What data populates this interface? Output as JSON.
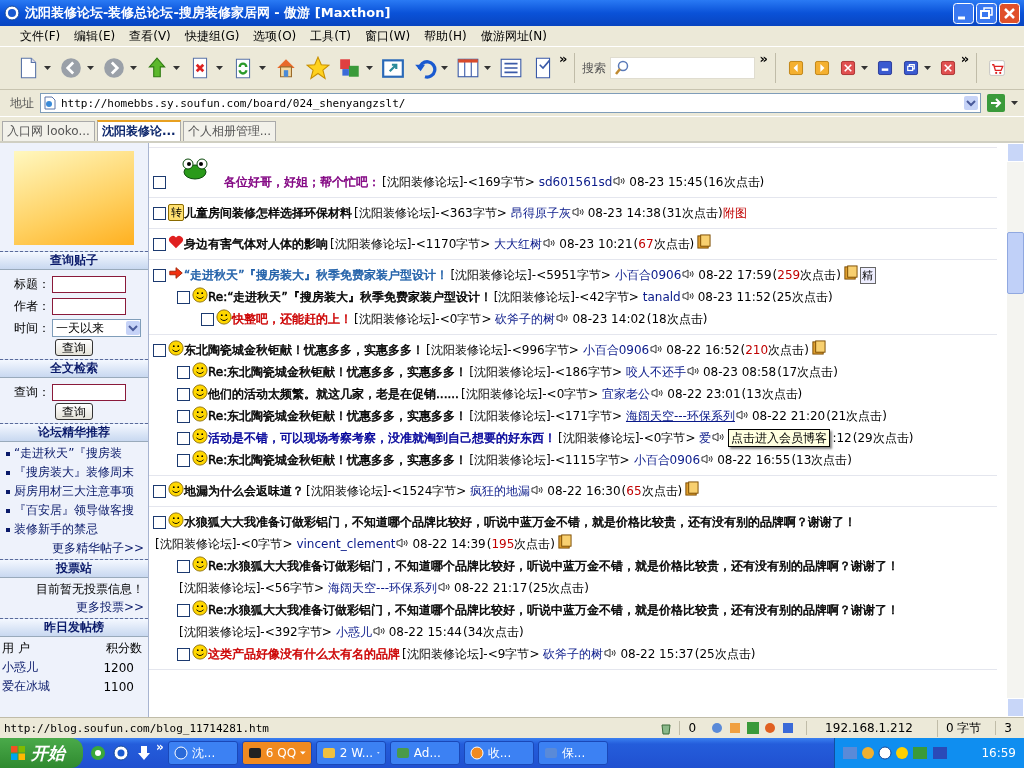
{
  "window": {
    "title": "沈阳装修论坛-装修总论坛-搜房装修家居网 - 傲游 [Maxthon]"
  },
  "menu": [
    "文件(F)",
    "编辑(E)",
    "查看(V)",
    "快捷组(G)",
    "选项(O)",
    "工具(T)",
    "窗口(W)",
    "帮助(H)",
    "傲游网址(N)"
  ],
  "toolbar": {
    "items": [
      {
        "kind": "page",
        "menu": true
      },
      {
        "kind": "back",
        "menu": true
      },
      {
        "kind": "forward",
        "menu": true
      },
      {
        "kind": "up",
        "menu": true
      },
      {
        "kind": "stop",
        "menu": true
      },
      {
        "kind": "refresh",
        "menu": true
      },
      {
        "kind": "home",
        "menu": false
      },
      {
        "kind": "star",
        "menu": false
      },
      {
        "kind": "translate",
        "menu": true
      },
      {
        "kind": "window",
        "menu": false
      },
      {
        "kind": "undo",
        "menu": true
      },
      {
        "kind": "columns",
        "menu": true
      },
      {
        "kind": "list",
        "menu": false
      },
      {
        "kind": "doc",
        "menu": false
      }
    ],
    "more": "»",
    "search": {
      "label": "搜索",
      "more": "»"
    },
    "right_items": [
      {
        "kind": "prev",
        "menu": false
      },
      {
        "kind": "next",
        "menu": false
      },
      {
        "kind": "close-tab",
        "menu": true
      },
      {
        "kind": "minimize",
        "menu": false
      },
      {
        "kind": "restore",
        "menu": true
      },
      {
        "kind": "close",
        "menu": false
      }
    ],
    "right_more": "»"
  },
  "address": {
    "label": "地址",
    "url": "http://homebbs.sy.soufun.com/board/024_shenyangzslt/"
  },
  "tabs": [
    {
      "label": "入口网 looko...",
      "selected": false
    },
    {
      "label": "沈阳装修论...",
      "selected": true
    },
    {
      "label": "个人相册管理...",
      "selected": false
    }
  ],
  "sidebar": {
    "search_posts": {
      "heading": "查询贴子",
      "fields": [
        {
          "label": "标题：",
          "kind": "text"
        },
        {
          "label": "作者：",
          "kind": "text"
        },
        {
          "label": "时间：",
          "kind": "select",
          "value": "一天以来"
        }
      ],
      "button": "查询"
    },
    "fulltext": {
      "heading": "全文检索",
      "fields": [
        {
          "label": "查询：",
          "kind": "text"
        }
      ],
      "button": "查询"
    },
    "featured": {
      "heading": "论坛精华推荐",
      "links": [
        "“走进秋天”『搜房装",
        "『搜房装大』装修周末",
        "厨房用材三大注意事项",
        "『百安居』领导做客搜",
        "装修新手的禁忌"
      ],
      "more": "更多精华帖子>>"
    },
    "votes": {
      "heading": "投票站",
      "message": "目前暂无投票信息！",
      "more": "更多投票>>"
    },
    "ranking": {
      "heading": "昨日发帖榜",
      "columns": [
        "用 户",
        "积分数"
      ],
      "rows": [
        [
          "小惑儿",
          "1200"
        ],
        [
          "爱在冰城",
          "1100"
        ]
      ]
    }
  },
  "threads": [
    {
      "kind": "frog",
      "checked": false,
      "title": "各位好哥，好姐；帮个忙吧：",
      "color": "#800080",
      "forum": "[沈阳装修论坛]-<169字节>",
      "author": "sd601561sd",
      "date": "08-23 15:45",
      "hits_open": "(",
      "hits": "16",
      "hits_close": "次点击)",
      "hot": false
    },
    {
      "kind": "plain",
      "badge": "转",
      "checked": false,
      "title": "儿童房间装修怎样选择环保材料",
      "color": "#000000",
      "forum": "[沈阳装修论坛]-<363字节>",
      "author": "昂得原子灰",
      "date": "08-23 14:38",
      "hits_open": "(",
      "hits": "31",
      "hits_close": "次点击)",
      "hot": false,
      "extras": [
        {
          "kind": "pic-link",
          "text": "附图"
        }
      ]
    },
    {
      "kind": "heart",
      "checked": false,
      "title": "身边有害气体对人体的影响",
      "color": "#000000",
      "forum": "[沈阳装修论坛]-<1170字节>",
      "author": "大大红树",
      "date": "08-23 10:21",
      "hits_open": "(",
      "hits": "67",
      "hits_close": "次点击)",
      "hot": true,
      "extras": [
        {
          "kind": "attachment"
        }
      ]
    },
    {
      "kind": "arrow",
      "checked": false,
      "title": "“走进秋天”『搜房装大』秋季免费家装户型设计！",
      "color": "#1f5fa8",
      "forum": "[沈阳装修论坛]-<5951字节>",
      "author": "小百合0906",
      "date": "08-22 17:59",
      "hits_open": "(",
      "hits": "259",
      "hits_close": "次点击)",
      "hot": true,
      "extras": [
        {
          "kind": "attachment"
        },
        {
          "kind": "elite",
          "text": "精"
        }
      ],
      "children": [
        {
          "kind": "smile",
          "checked": false,
          "title": "Re:“走进秋天”『搜房装大』秋季免费家装户型设计！",
          "color": "#000000",
          "forum": "[沈阳装修论坛]-<42字节>",
          "author": "tanald",
          "date": "08-23 11:52",
          "hits_open": "(",
          "hits": "25",
          "hits_close": "次点击)",
          "hot": false,
          "children": [
            {
              "kind": "smile",
              "checked": false,
              "title": "快整吧，还能赶的上！",
              "color": "#cc0000",
              "forum": "[沈阳装修论坛]-<0字节>",
              "author": "砍斧子的树",
              "date": "08-23 14:02",
              "hits_open": "(",
              "hits": "18",
              "hits_close": "次点击)",
              "hot": false
            }
          ]
        }
      ]
    },
    {
      "kind": "smile",
      "checked": false,
      "title": "东北陶瓷城金秋钜献！忧惠多多，实惠多多！",
      "color": "#000000",
      "forum": "[沈阳装修论坛]-<996字节>",
      "author": "小百合0906",
      "date": "08-22 16:52",
      "hits_open": "(",
      "hits": "210",
      "hits_close": "次点击)",
      "hot": true,
      "extras": [
        {
          "kind": "attachment"
        }
      ],
      "children": [
        {
          "kind": "smile",
          "checked": false,
          "title": "Re:东北陶瓷城金秋钜献！忧惠多多，实惠多多！",
          "color": "#000000",
          "forum": "[沈阳装修论坛]-<186字节>",
          "author": "咬人不还手",
          "date": "08-23 08:58",
          "hits_open": "(",
          "hits": "17",
          "hits_close": "次点击)",
          "hot": false
        },
        {
          "kind": "smile",
          "checked": false,
          "title": "他们的活动太频繁。就这几家，老是在促销......",
          "color": "#000000",
          "forum": "[沈阳装修论坛]-<0字节>",
          "author": "宜家老公",
          "date": "08-22 23:01",
          "hits_open": "(",
          "hits": "13",
          "hits_close": "次点击)",
          "hot": false
        },
        {
          "kind": "smile",
          "checked": false,
          "title": "Re:东北陶瓷城金秋钜献！忧惠多多，实惠多多！",
          "color": "#000000",
          "forum": "[沈阳装修论坛]-<171字节>",
          "author": "海阔天空---环保系列",
          "underline": true,
          "date": "08-22 21:20",
          "hits_open": "(",
          "hits": "21",
          "hits_close": "次点击)",
          "hot": false
        },
        {
          "kind": "smile",
          "checked": false,
          "title": "活动是不错，可以现场考察考察，没准就淘到自己想要的好东西！",
          "color": "#000099",
          "forum": "[沈阳装修论坛]-<0字节>",
          "author": "爱",
          "tooltip": "点击进入会员博客",
          "date": ":12",
          "hits_open": "(",
          "hits": "29",
          "hits_close": "次点击)",
          "hot": false
        },
        {
          "kind": "smile",
          "checked": false,
          "title": "Re:东北陶瓷城金秋钜献！忧惠多多，实惠多多！",
          "color": "#000000",
          "forum": "[沈阳装修论坛]-<1115字节>",
          "author": "小百合0906",
          "date": "08-22 16:55",
          "hits_open": "(",
          "hits": "13",
          "hits_close": "次点击)",
          "hot": false
        }
      ]
    },
    {
      "kind": "smile",
      "checked": false,
      "title": "地漏为什么会返味道？",
      "color": "#000000",
      "forum": "[沈阳装修论坛]-<1524字节>",
      "author": "疯狂的地漏",
      "date": "08-22 16:30",
      "hits_open": "(",
      "hits": "65",
      "hits_close": "次点击)",
      "hot": true,
      "extras": [
        {
          "kind": "attachment"
        }
      ]
    },
    {
      "kind": "smile",
      "checked": false,
      "title": "水狼狐大大我准备订做彩铝门，不知道哪个品牌比较好，听说中蓝万金不错，就是价格比较贵，还有没有别的品牌啊？谢谢了！",
      "color": "#000000",
      "forum": "[沈阳装修论坛]-<0字节>",
      "author": "vincent_clement",
      "date": "08-22 14:39",
      "hits_open": "(",
      "hits": "195",
      "hits_close": "次点击)",
      "hot": true,
      "extras": [
        {
          "kind": "attachment"
        }
      ],
      "children": [
        {
          "kind": "smile",
          "checked": false,
          "title": "Re:水狼狐大大我准备订做彩铝门，不知道哪个品牌比较好，听说中蓝万金不错，就是价格比较贵，还有没有别的品牌啊？谢谢了！",
          "color": "#000000",
          "forum": "[沈阳装修论坛]-<56字节>",
          "author": "海阔天空---环保系列",
          "date": "08-22 21:17",
          "hits_open": "(",
          "hits": "25",
          "hits_close": "次点击)",
          "hot": false
        },
        {
          "kind": "smile",
          "checked": false,
          "title": "Re:水狼狐大大我准备订做彩铝门，不知道哪个品牌比较好，听说中蓝万金不错，就是价格比较贵，还有没有别的品牌啊？谢谢了！",
          "color": "#000000",
          "forum": "[沈阳装修论坛]-<392字节>",
          "author": "小惑儿",
          "date": "08-22 15:44",
          "hits_open": "(",
          "hits": "34",
          "hits_close": "次点击)",
          "hot": false
        },
        {
          "kind": "smile",
          "checked": false,
          "title": "这类产品好像没有什么太有名的品牌",
          "color": "#cc0000",
          "forum": "[沈阳装修论坛]-<9字节>",
          "author": "砍斧子的树",
          "date": "08-22 15:37",
          "hits_open": "(",
          "hits": "25",
          "hits_close": "次点击)",
          "hot": false
        }
      ]
    }
  ],
  "status_bar": {
    "url": "http://blog.soufun.com/blog_11714281.htm",
    "count": "0",
    "ip": "192.168.1.212",
    "bytes": "0 字节",
    "number": "3"
  },
  "taskbar": {
    "start": "开始",
    "more": "»",
    "tasks": [
      {
        "label": "沈...",
        "kind": "browser",
        "flash": false,
        "menu": false
      },
      {
        "label": "6 QQ",
        "kind": "penguin",
        "flash": true,
        "menu": true
      },
      {
        "label": "2 W...",
        "kind": "folder",
        "flash": false,
        "menu": true
      },
      {
        "label": "Ad...",
        "kind": "app",
        "flash": false,
        "menu": false
      },
      {
        "label": "收...",
        "kind": "clock",
        "flash": false,
        "menu": false
      },
      {
        "label": "保...",
        "kind": "doc",
        "flash": false,
        "menu": false
      }
    ],
    "clock": "16:59"
  }
}
